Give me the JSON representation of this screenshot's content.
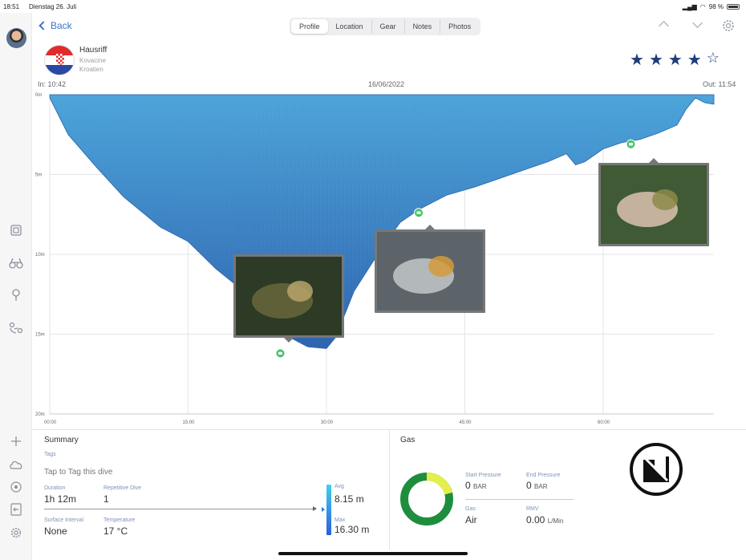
{
  "status": {
    "time": "18:51",
    "date": "Dienstag 26. Juli",
    "battery": "98 %"
  },
  "nav": {
    "back_label": "Back",
    "tabs": [
      {
        "label": "Profile",
        "active": true
      },
      {
        "label": "Location",
        "active": false
      },
      {
        "label": "Gear",
        "active": false
      },
      {
        "label": "Notes",
        "active": false
      },
      {
        "label": "Photos",
        "active": false
      }
    ]
  },
  "dive": {
    "site": "Hausriff",
    "place": "Kovacine",
    "country": "Kroatien",
    "rating": 4,
    "rating_max": 5,
    "time_in": "In: 10:42",
    "date": "16/06/2022",
    "time_out": "Out: 11:54"
  },
  "chart_data": {
    "type": "area",
    "x_ticks": [
      "00:00",
      "15:00",
      "30:00",
      "45:00",
      "60:00"
    ],
    "y_ticks": [
      "0m",
      "5m",
      "10m",
      "15m",
      "20m"
    ],
    "xlim": [
      0,
      72
    ],
    "ylim": [
      0,
      20
    ],
    "y_inverted": true,
    "grid": true,
    "fill_color": "#2f78c0",
    "x": [
      0,
      2,
      5,
      8,
      12,
      15,
      18,
      21,
      24,
      26,
      28,
      30,
      31,
      33,
      36,
      38,
      40,
      43,
      46,
      48,
      50,
      52,
      54,
      56,
      57,
      58,
      60,
      62,
      64,
      66,
      68,
      69,
      70,
      71,
      72
    ],
    "y": [
      0.2,
      2.5,
      4.5,
      6.4,
      8.3,
      9.2,
      10.9,
      12.3,
      13.7,
      15.2,
      15.8,
      15.9,
      15.2,
      12.3,
      9.6,
      8.0,
      7.2,
      6.3,
      5.8,
      5.4,
      5.0,
      4.6,
      4.2,
      3.7,
      4.4,
      4.2,
      3.4,
      3.0,
      2.8,
      2.4,
      1.9,
      0.9,
      0.2,
      0.5,
      0.6
    ],
    "photo_markers": [
      {
        "time": 25,
        "depth": 16.2,
        "photo": "crab"
      },
      {
        "time": 40,
        "depth": 7.4,
        "photo": "tube-worm"
      },
      {
        "time": 63,
        "depth": 3.1,
        "photo": "hand-shell"
      }
    ]
  },
  "summary": {
    "title": "Summary",
    "tags_label": "Tags",
    "tag_prompt": "Tap to Tag this dive",
    "duration_label": "Duration",
    "duration": "1h 12m",
    "repetitive_label": "Repetitive Dive",
    "repetitive": "1",
    "surface_label": "Surface Interval",
    "surface": "None",
    "temperature_label": "Temperature",
    "temperature": "17 °C",
    "avg_label": "Avg",
    "avg": "8.15 m",
    "max_label": "Max",
    "max": "16.30 m"
  },
  "gas": {
    "title": "Gas",
    "start_label": "Start Pressure",
    "start": "0",
    "start_unit": "BAR",
    "end_label": "End Pressure",
    "end": "0",
    "end_unit": "BAR",
    "gas_label": "Gas",
    "gas": "Air",
    "rmv_label": "RMV",
    "rmv": "0.00",
    "rmv_unit": "L/Min",
    "donut_colors": {
      "main": "#1e8e3e",
      "accent": "#e3ef4b"
    }
  },
  "icons": [
    "back-chevron",
    "profile-icon",
    "binoculars-icon",
    "pin-icon",
    "diver-icon",
    "plus-icon",
    "cloud-icon",
    "target-icon",
    "import-icon",
    "gear-icon"
  ]
}
